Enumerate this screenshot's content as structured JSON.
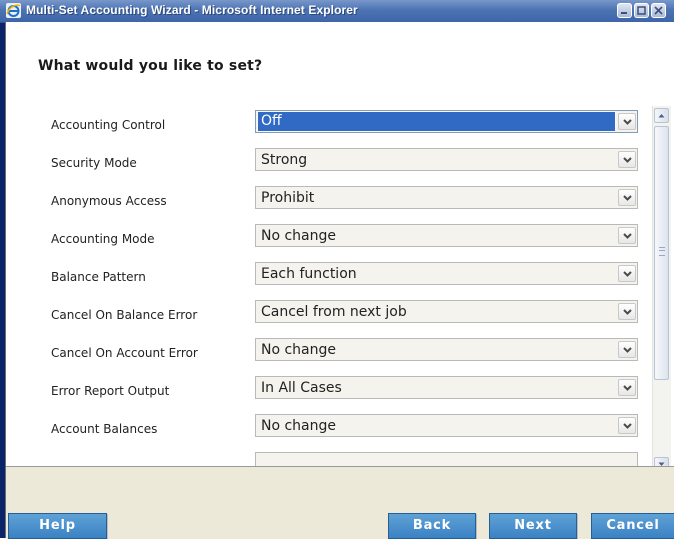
{
  "window": {
    "title": "Multi-Set Accounting Wizard - Microsoft Internet Explorer"
  },
  "page": {
    "heading": "What would you like to set?"
  },
  "settings": [
    {
      "label": "Accounting Control",
      "value": "Off"
    },
    {
      "label": "Security Mode",
      "value": "Strong"
    },
    {
      "label": "Anonymous Access",
      "value": "Prohibit"
    },
    {
      "label": "Accounting Mode",
      "value": "No change"
    },
    {
      "label": "Balance Pattern",
      "value": "Each function"
    },
    {
      "label": "Cancel On Balance Error",
      "value": "Cancel from next job"
    },
    {
      "label": "Cancel On Account Error",
      "value": "No change"
    },
    {
      "label": "Error Report Output",
      "value": "In All Cases"
    },
    {
      "label": "Account Balances",
      "value": "No change"
    }
  ],
  "footer": {
    "help_label": "Help",
    "back_label": "Back",
    "next_label": "Next",
    "cancel_label": "Cancel"
  },
  "colors": {
    "title_bar": "#4d73b3",
    "selection": "#316ac5",
    "button": "#3b82c4",
    "footer_bg": "#ece9d8"
  }
}
